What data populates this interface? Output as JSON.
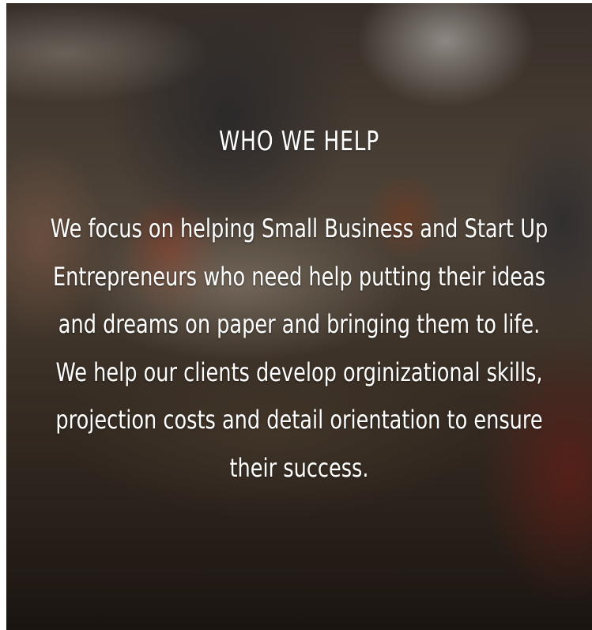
{
  "section": {
    "title": "WHO WE HELP",
    "lines": [
      "We focus on helping Small Business and Start Up",
      "Entrepreneurs who need help putting their ideas",
      "and dreams on paper and bringing them to life.",
      "We help our clients develop orginizational skills,",
      "projection costs and detail orientation to ensure",
      "their success."
    ]
  }
}
